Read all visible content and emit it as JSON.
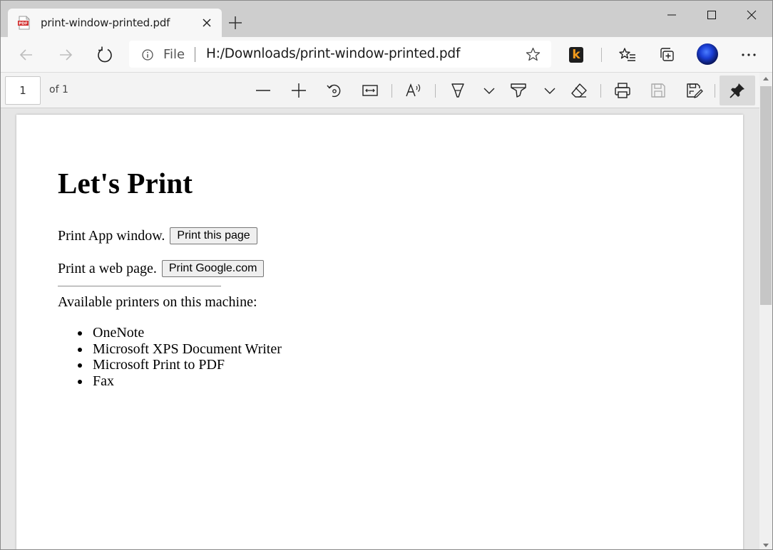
{
  "tab": {
    "title": "print-window-printed.pdf",
    "favicon_label": "PDF"
  },
  "address": {
    "scheme_label": "File",
    "url": "H:/Downloads/print-window-printed.pdf"
  },
  "toolbar": {
    "extension_badge": "k"
  },
  "pdf_toolbar": {
    "page_number": "1",
    "page_count_label": "of 1"
  },
  "document": {
    "heading": "Let's Print",
    "line1_text": "Print App window.",
    "line1_button": "Print this page",
    "line2_text": "Print a web page.",
    "line2_button": "Print Google.com",
    "printers_label": "Available printers on this machine:",
    "printers": [
      "OneNote",
      "Microsoft XPS Document Writer",
      "Microsoft Print to PDF",
      "Fax"
    ]
  },
  "colors": {
    "tabstrip": "#cecece",
    "toolbar": "#f7f7f7",
    "pdf_toolbar": "#f3f3f3",
    "viewer_bg": "#e6e6e6",
    "accent_pdf": "#d32f2f",
    "badge_orange": "#f39b1c"
  },
  "icons": [
    "pdf-file-icon",
    "close-icon",
    "plus-icon",
    "minimize-icon",
    "maximize-icon",
    "back-arrow-icon",
    "forward-arrow-icon",
    "refresh-icon",
    "info-icon",
    "star-icon",
    "favorites-icon",
    "collections-icon",
    "more-icon",
    "zoom-out-icon",
    "zoom-in-icon",
    "rotate-icon",
    "fit-page-icon",
    "read-aloud-icon",
    "draw-icon",
    "highlight-icon",
    "eraser-icon",
    "print-icon",
    "save-icon",
    "save-as-icon",
    "pin-icon"
  ]
}
